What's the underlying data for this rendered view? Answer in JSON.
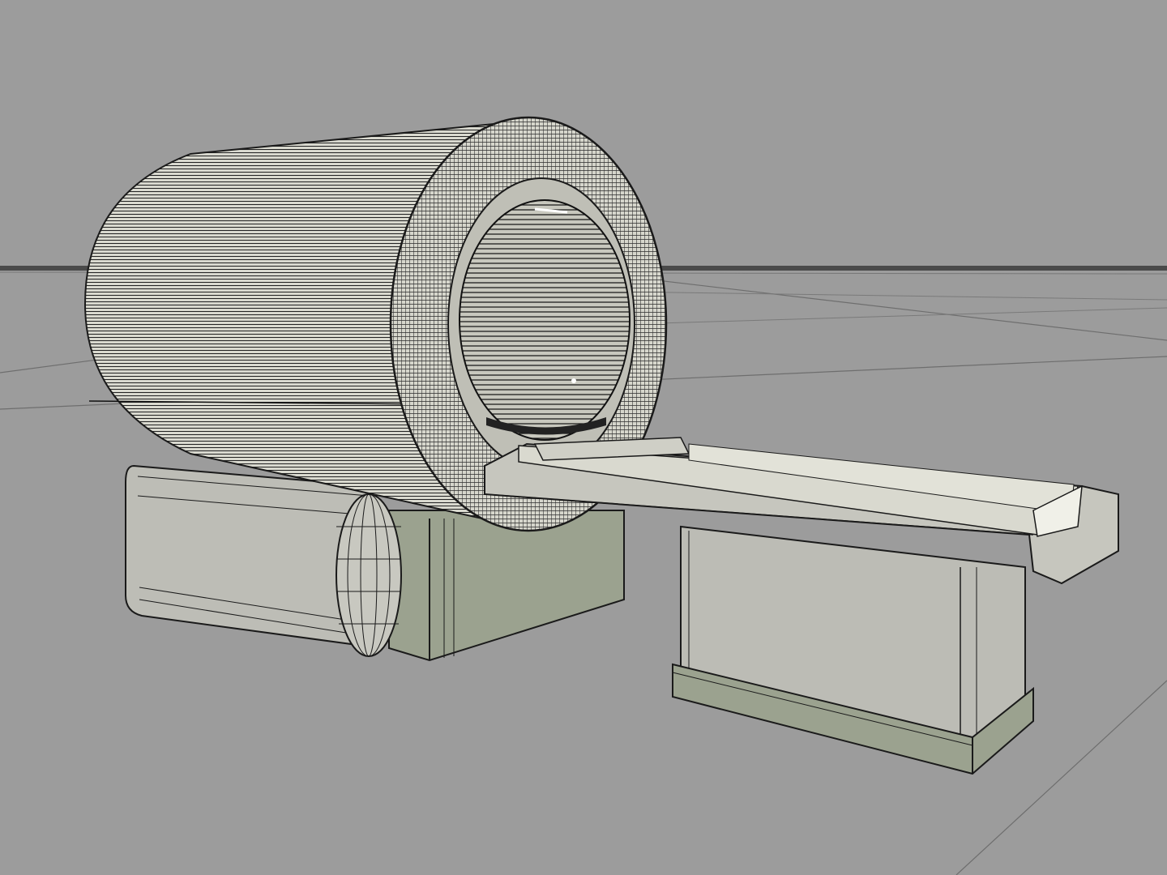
{
  "viewport": {
    "view_mode": "wireframe-shaded",
    "background_color": "#9c9c9c",
    "horizon_color": "#4a4a4a"
  },
  "model": {
    "object": "scanner-gantry-with-patient-table",
    "surface_color": "#dcdcd2",
    "base_color": "#9aa290",
    "wire_color": "#1a1a1a"
  }
}
